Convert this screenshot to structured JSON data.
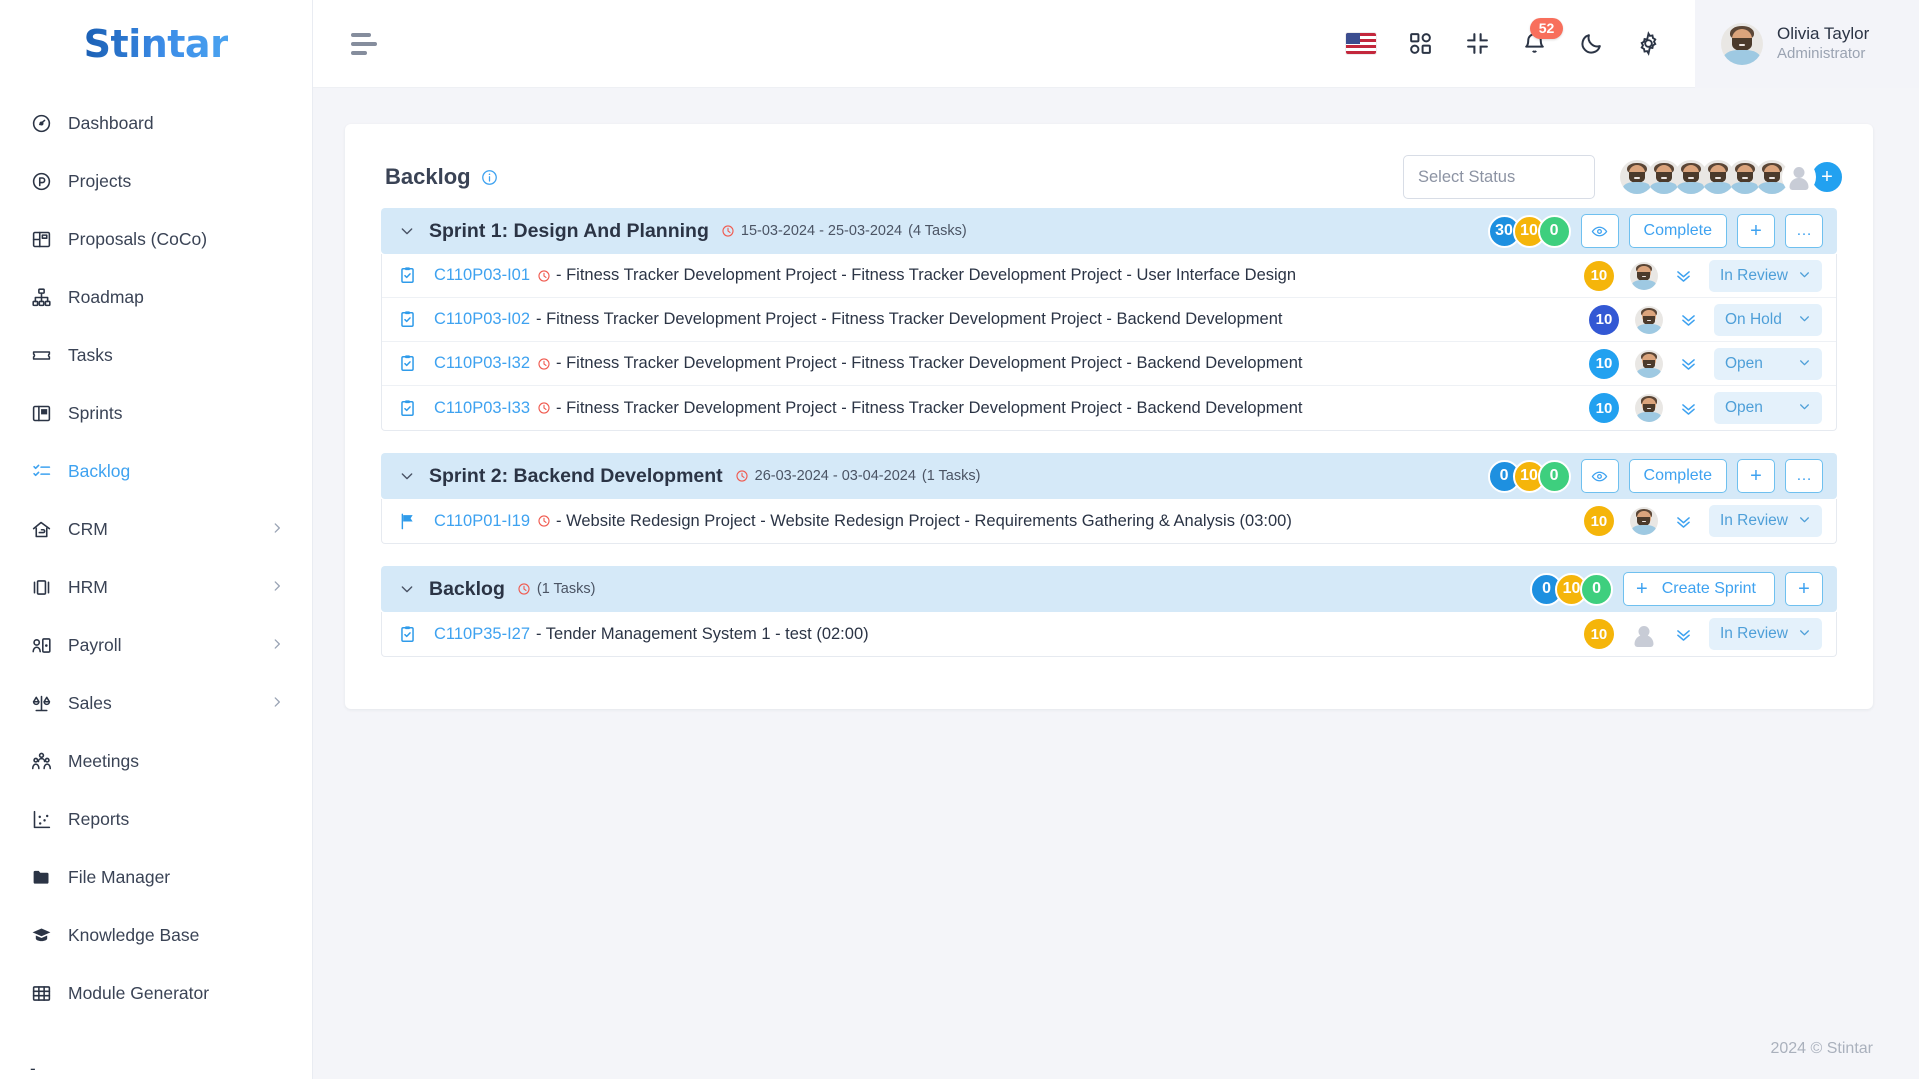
{
  "brand": {
    "name": "Stintar"
  },
  "sidebar": {
    "items": [
      {
        "label": "Dashboard",
        "icon": "gauge-icon",
        "active": false,
        "expandable": false
      },
      {
        "label": "Projects",
        "icon": "circle-p-icon",
        "active": false,
        "expandable": false
      },
      {
        "label": "Proposals (CoCo)",
        "icon": "layout-icon",
        "active": false,
        "expandable": false
      },
      {
        "label": "Roadmap",
        "icon": "hierarchy-icon",
        "active": false,
        "expandable": false
      },
      {
        "label": "Tasks",
        "icon": "ticket-icon",
        "active": false,
        "expandable": false
      },
      {
        "label": "Sprints",
        "icon": "board-icon",
        "active": false,
        "expandable": false
      },
      {
        "label": "Backlog",
        "icon": "checklist-icon",
        "active": true,
        "expandable": false
      },
      {
        "label": "CRM",
        "icon": "handshake-icon",
        "active": false,
        "expandable": true
      },
      {
        "label": "HRM",
        "icon": "id-card-icon",
        "active": false,
        "expandable": true
      },
      {
        "label": "Payroll",
        "icon": "user-card-icon",
        "active": false,
        "expandable": true
      },
      {
        "label": "Sales",
        "icon": "scale-icon",
        "active": false,
        "expandable": true
      },
      {
        "label": "Meetings",
        "icon": "people-icon",
        "active": false,
        "expandable": false
      },
      {
        "label": "Reports",
        "icon": "scatter-chart-icon",
        "active": false,
        "expandable": false
      },
      {
        "label": "File Manager",
        "icon": "folder-icon",
        "active": false,
        "expandable": false
      },
      {
        "label": "Knowledge Base",
        "icon": "graduation-cap-icon",
        "active": false,
        "expandable": false
      },
      {
        "label": "Module Generator",
        "icon": "grid-table-icon",
        "active": false,
        "expandable": false
      }
    ],
    "trailing": "-"
  },
  "topbar": {
    "menu_icon": "hamburger-icon",
    "language_flag": "us-flag-icon",
    "apps_icon": "apps-grid-icon",
    "collapse_icon": "compress-icon",
    "notifications_icon": "bell-icon",
    "notifications_count": "52",
    "theme_icon": "moon-icon",
    "settings_icon": "gear-icon",
    "user": {
      "name": "Olivia Taylor",
      "role": "Administrator"
    }
  },
  "page": {
    "title": "Backlog",
    "info_icon": "info-circle-icon",
    "status_filter_placeholder": "Select Status",
    "member_avatars": 6,
    "add_member_label": "+"
  },
  "groups": [
    {
      "name": "Sprint 1: Design And Planning",
      "date_range": "15-03-2024 - 25-03-2024",
      "task_count_label": "(4 Tasks)",
      "pills": [
        {
          "value": "30",
          "color": "blue"
        },
        {
          "value": "10",
          "color": "amber"
        },
        {
          "value": "0",
          "color": "green"
        }
      ],
      "actions": {
        "view_icon": "eye-icon",
        "complete_label": "Complete",
        "add_label": "+",
        "more_label": "…"
      },
      "type": "sprint",
      "tasks": [
        {
          "icon": "clipboard-check-icon",
          "key": "C110P03-I01",
          "has_clock": true,
          "text": "- Fitness Tracker Development Project - Fitness Tracker Development Project - User Interface Design",
          "points": "10",
          "points_color": "amber",
          "assignee": "avatar",
          "status": "In Review"
        },
        {
          "icon": "clipboard-check-icon",
          "key": "C110P03-I02",
          "has_clock": false,
          "text": "- Fitness Tracker Development Project - Fitness Tracker Development Project - Backend Development",
          "points": "10",
          "points_color": "navy",
          "assignee": "avatar",
          "status": "On Hold"
        },
        {
          "icon": "clipboard-check-icon",
          "key": "C110P03-I32",
          "has_clock": true,
          "text": "- Fitness Tracker Development Project - Fitness Tracker Development Project - Backend Development",
          "points": "10",
          "points_color": "blue",
          "assignee": "avatar",
          "status": "Open"
        },
        {
          "icon": "clipboard-check-icon",
          "key": "C110P03-I33",
          "has_clock": true,
          "text": "- Fitness Tracker Development Project - Fitness Tracker Development Project - Backend Development",
          "points": "10",
          "points_color": "blue",
          "assignee": "avatar",
          "status": "Open"
        }
      ]
    },
    {
      "name": "Sprint 2: Backend Development",
      "date_range": "26-03-2024 - 03-04-2024",
      "task_count_label": "(1 Tasks)",
      "pills": [
        {
          "value": "0",
          "color": "blue"
        },
        {
          "value": "10",
          "color": "amber"
        },
        {
          "value": "0",
          "color": "green"
        }
      ],
      "actions": {
        "view_icon": "eye-icon",
        "complete_label": "Complete",
        "add_label": "+",
        "more_label": "…"
      },
      "type": "sprint",
      "tasks": [
        {
          "icon": "flag-icon",
          "key": "C110P01-I19",
          "has_clock": true,
          "text": "- Website Redesign Project - Website Redesign Project - Requirements Gathering & Analysis (03:00)",
          "points": "10",
          "points_color": "amber",
          "assignee": "avatar",
          "status": "In Review"
        }
      ]
    },
    {
      "name": "Backlog",
      "date_range": "",
      "task_count_label": "(1 Tasks)",
      "pills": [
        {
          "value": "0",
          "color": "blue"
        },
        {
          "value": "10",
          "color": "amber"
        },
        {
          "value": "0",
          "color": "green"
        }
      ],
      "actions": {
        "create_sprint_label": "Create Sprint",
        "add_label": "+"
      },
      "type": "backlog",
      "tasks": [
        {
          "icon": "clipboard-check-icon",
          "key": "C110P35-I27",
          "has_clock": false,
          "text": "- Tender Management System 1 - test (02:00)",
          "points": "10",
          "points_color": "amber",
          "assignee": "generic",
          "status": "In Review"
        }
      ]
    }
  ],
  "footer": {
    "copyright": "2024 © Stintar"
  },
  "colors": {
    "accent": "#3ea2f0",
    "group_header_bg": "#d5e9f8",
    "pill_blue": "#1e90e0",
    "pill_amber": "#f5b50a",
    "pill_green": "#3ecf7e",
    "badge_red": "#f86f5c"
  }
}
